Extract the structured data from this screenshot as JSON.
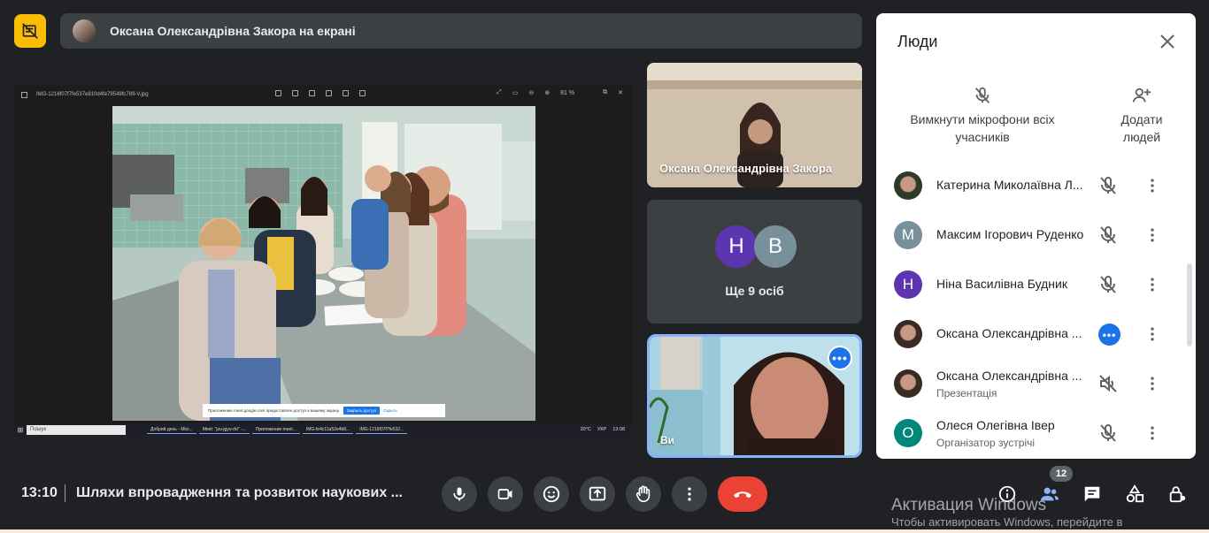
{
  "presenter_bar": {
    "text": "Оксана Олександрівна Закора на екрані"
  },
  "shared_screen": {
    "viewer_filename": "IMG-1216f07f7fe537e810d4fe79549fc789-V.jpg",
    "zoom": "81 %",
    "share_notice": "Приложению meet.google.com предоставлен доступ к вашему экрану.",
    "share_stop": "Закрыть доступ",
    "share_hide": "Скрыть",
    "taskbar": {
      "search": "Пошук",
      "apps": [
        "Добрий день - Micr...",
        "Meet: \"jzu-jgyu-rbi\" -...",
        "Приложение meet...",
        "IMG-fe4c11a52e4b8...",
        "IMG-1216f07f7fe532..."
      ],
      "weather": "20°C",
      "lang": "УКР",
      "time": "13:08"
    }
  },
  "tiles": {
    "presenter_name": "Оксана Олександрівна Закора",
    "others_initials": [
      "Н",
      "В"
    ],
    "others_colors": [
      "#5e35b1",
      "#78909c"
    ],
    "others_label": "Ще 9 осіб",
    "self_name": "Ви"
  },
  "panel": {
    "title": "Люди",
    "mute_all": "Вимкнути мікрофони всіх учасників",
    "add_people": "Додати людей",
    "participants": [
      {
        "name": "Катерина Миколаївна Л...",
        "sub": "",
        "initial": "",
        "color": "#2d3a2a",
        "photo": true,
        "mic": "muted"
      },
      {
        "name": "Максим Ігорович Руденко",
        "sub": "",
        "initial": "М",
        "color": "#78909c",
        "photo": false,
        "mic": "muted"
      },
      {
        "name": "Ніна Василівна Будник",
        "sub": "",
        "initial": "Н",
        "color": "#5e35b1",
        "photo": false,
        "mic": "muted"
      },
      {
        "name": "Оксана Олександрівна ...",
        "sub": "",
        "initial": "",
        "color": "#3a2a24",
        "photo": true,
        "mic": "active"
      },
      {
        "name": "Оксана Олександрівна ...",
        "sub": "Презентація",
        "initial": "",
        "color": "#3a2a24",
        "photo": true,
        "mic": "volume-off"
      },
      {
        "name": "Олеся Олегівна Івер",
        "sub": "Організатор зустрічі",
        "initial": "О",
        "color": "#00897b",
        "photo": false,
        "mic": "muted"
      }
    ]
  },
  "bottom": {
    "time": "13:10",
    "meeting_title": "Шляхи впровадження та розвиток наукових ...",
    "people_count": "12"
  },
  "watermark": {
    "title": "Активация Windows",
    "subtitle": "Чтобы активировать Windows, перейдите в"
  },
  "colors": {
    "accent": "#1a73e8",
    "end_call": "#ea4335",
    "layout_btn": "#fbbc04"
  }
}
